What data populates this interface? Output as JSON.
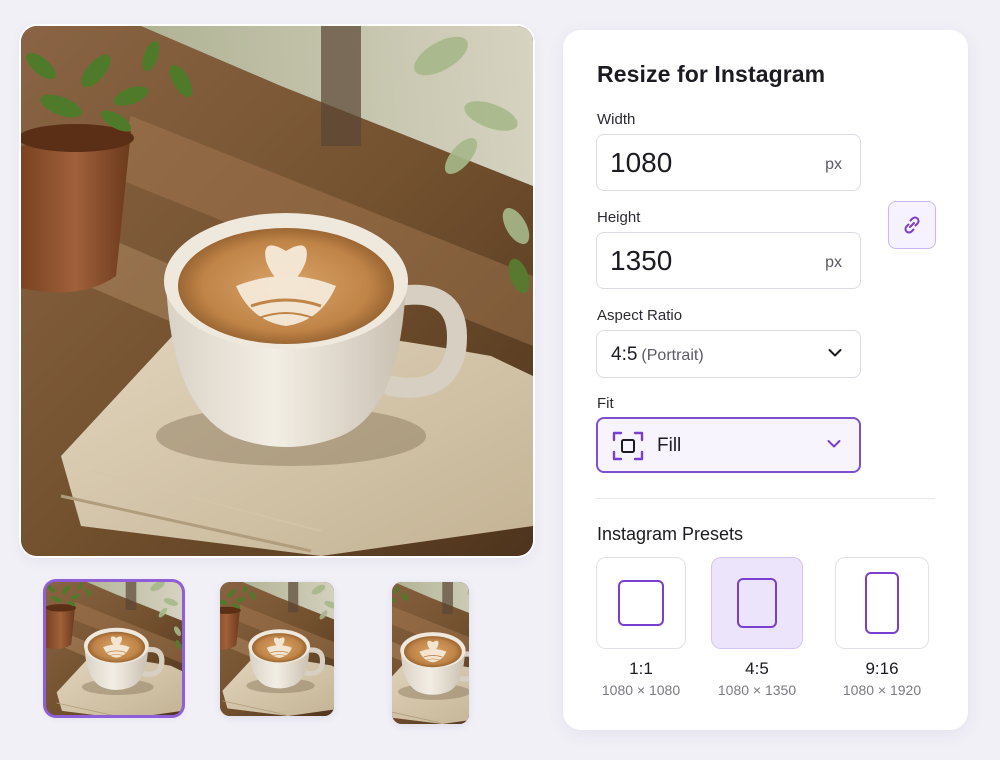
{
  "panel": {
    "title": "Resize for Instagram",
    "width": {
      "label": "Width",
      "value": "1080",
      "unit": "px"
    },
    "height": {
      "label": "Height",
      "value": "1350",
      "unit": "px"
    },
    "link_icon": "link-icon",
    "aspect_ratio": {
      "label": "Aspect Ratio",
      "value": "4:5",
      "value_note": "(Portrait)"
    },
    "fit": {
      "label": "Fit",
      "value": "Fill",
      "icon": "fill-frame-icon"
    },
    "presets": {
      "title": "Instagram Presets",
      "items": [
        {
          "ratio": "1:1",
          "dims": "1080 × 1080",
          "selected": false
        },
        {
          "ratio": "4:5",
          "dims": "1080 × 1350",
          "selected": true
        },
        {
          "ratio": "9:16",
          "dims": "1080 × 1920",
          "selected": false
        }
      ]
    }
  },
  "thumbnails": [
    {
      "crop": "1:1",
      "selected": true
    },
    {
      "crop": "4:5",
      "selected": false
    },
    {
      "crop": "9:16",
      "selected": false
    }
  ],
  "colors": {
    "accent": "#7e50cf",
    "accent_light": "#ece4fb",
    "background": "#f1f0f7",
    "panel": "#ffffff"
  }
}
